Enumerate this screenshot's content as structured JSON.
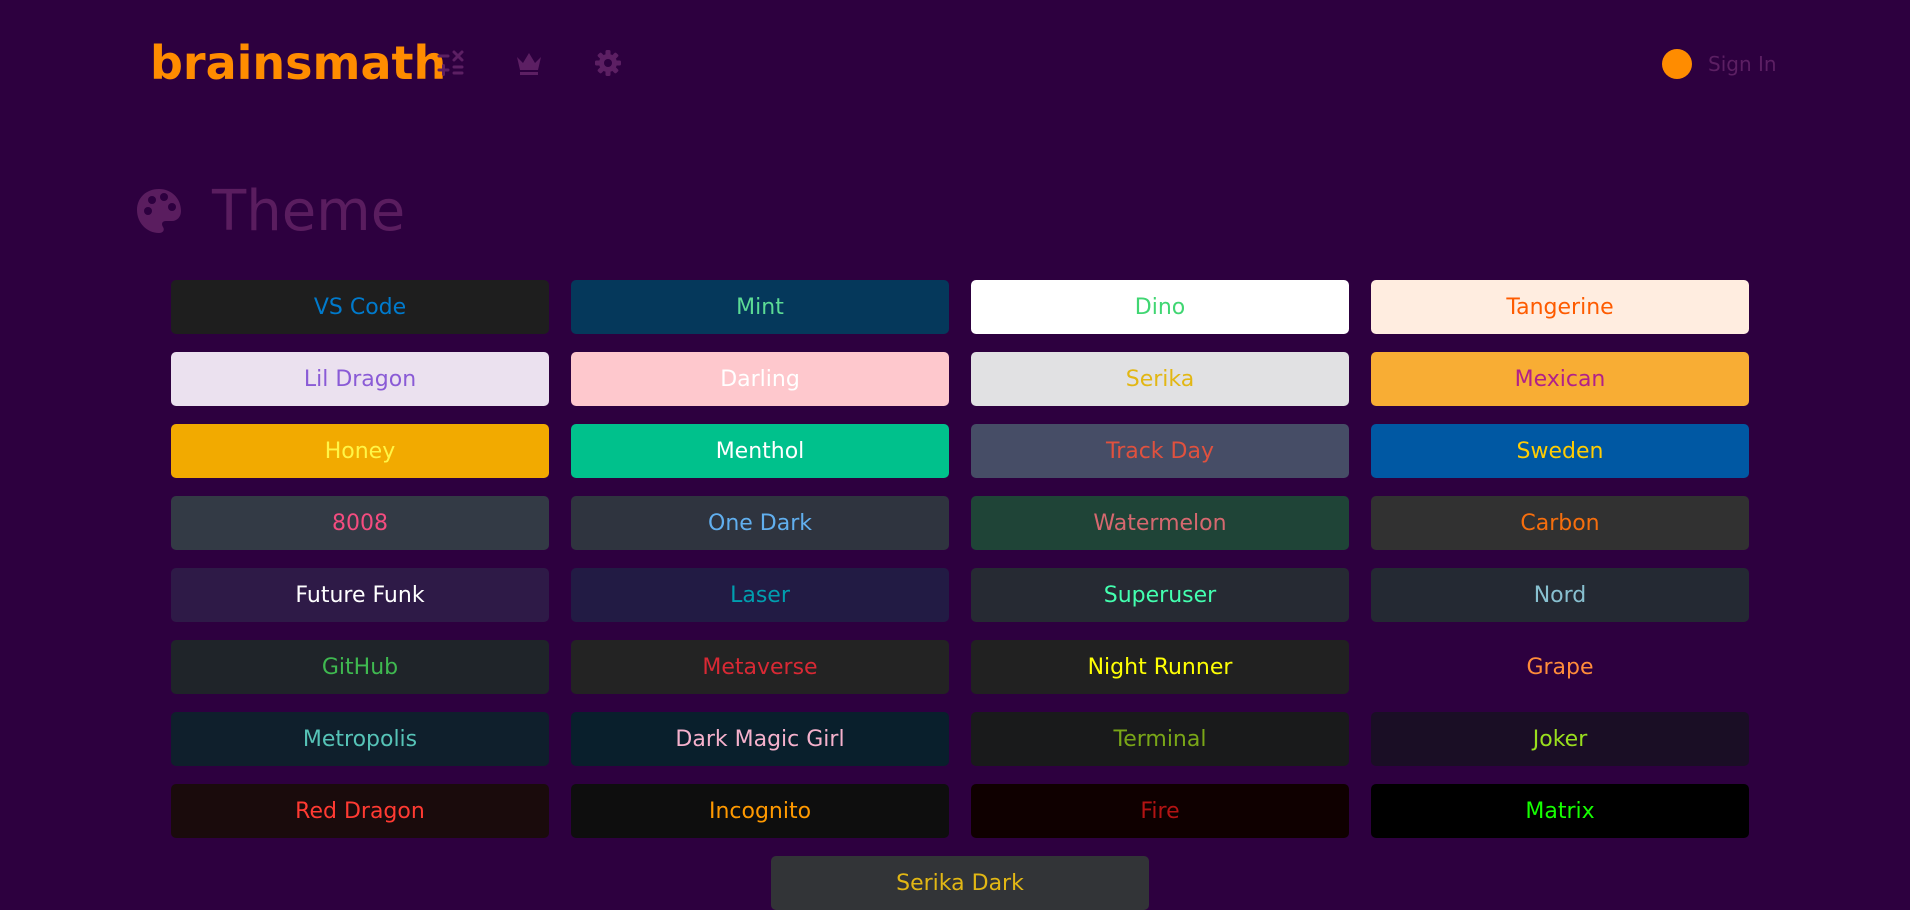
{
  "header": {
    "logo": "brainsmath",
    "nav_icons": [
      "calculator-icon",
      "crown-icon",
      "gear-icon"
    ],
    "sign_in_label": "Sign In"
  },
  "section": {
    "title": "Theme",
    "icon": "palette-icon"
  },
  "colors": {
    "background": "#2d003f",
    "accent": "#ff8c00",
    "muted": "#5c1f63"
  },
  "themes": [
    {
      "name": "VS Code",
      "bg": "#1e1e1e",
      "fg": "#007acc"
    },
    {
      "name": "Mint",
      "bg": "#05385b",
      "fg": "#5cdb95"
    },
    {
      "name": "Dino",
      "bg": "#ffffff",
      "fg": "#40d672"
    },
    {
      "name": "Tangerine",
      "bg": "#ffede0",
      "fg": "#fe5b00"
    },
    {
      "name": "Lil Dragon",
      "bg": "#ebe1ef",
      "fg": "#8a5bd6"
    },
    {
      "name": "Darling",
      "bg": "#fec8cd",
      "fg": "#ffffff"
    },
    {
      "name": "Serika",
      "bg": "#e1e1e3",
      "fg": "#e2b714"
    },
    {
      "name": "Mexican",
      "bg": "#f8ad34",
      "fg": "#b12189"
    },
    {
      "name": "Honey",
      "bg": "#f2aa00",
      "fg": "#fff546"
    },
    {
      "name": "Menthol",
      "bg": "#00c18c",
      "fg": "#ffffff"
    },
    {
      "name": "Track Day",
      "bg": "#464d66",
      "fg": "#e0513e"
    },
    {
      "name": "Sweden",
      "bg": "#0058a3",
      "fg": "#ffcc02"
    },
    {
      "name": "8008",
      "bg": "#333a45",
      "fg": "#f44c7f"
    },
    {
      "name": "One Dark",
      "bg": "#2f343f",
      "fg": "#61afef"
    },
    {
      "name": "Watermelon",
      "bg": "#1f4437",
      "fg": "#d6686f"
    },
    {
      "name": "Carbon",
      "bg": "#313131",
      "fg": "#f66e0d"
    },
    {
      "name": "Future Funk",
      "bg": "#2e1a47",
      "fg": "#ffffff"
    },
    {
      "name": "Laser",
      "bg": "#221b44",
      "fg": "#009eaf"
    },
    {
      "name": "Superuser",
      "bg": "#262a33",
      "fg": "#43ffaf"
    },
    {
      "name": "Nord",
      "bg": "#242933",
      "fg": "#88c0d0"
    },
    {
      "name": "GitHub",
      "bg": "#1f2429",
      "fg": "#3fb950"
    },
    {
      "name": "Metaverse",
      "bg": "#232323",
      "fg": "#d82934"
    },
    {
      "name": "Night Runner",
      "bg": "#212121",
      "fg": "#feff04"
    },
    {
      "name": "Grape",
      "bg": "#2d003f",
      "fg": "#ff8c3a"
    },
    {
      "name": "Metropolis",
      "bg": "#0f1f2c",
      "fg": "#56c3b7"
    },
    {
      "name": "Dark Magic Girl",
      "bg": "#091f2c",
      "fg": "#f5b1cc"
    },
    {
      "name": "Terminal",
      "bg": "#191a1b",
      "fg": "#79a617"
    },
    {
      "name": "Joker",
      "bg": "#1a0e25",
      "fg": "#99de1e"
    },
    {
      "name": "Red Dragon",
      "bg": "#1a0b0c",
      "fg": "#ff3a32"
    },
    {
      "name": "Incognito",
      "bg": "#0e0e0e",
      "fg": "#ff9900"
    },
    {
      "name": "Fire",
      "bg": "#0f0000",
      "fg": "#b31313"
    },
    {
      "name": "Matrix",
      "bg": "#000000",
      "fg": "#15ff00"
    },
    {
      "name": "Serika Dark",
      "bg": "#323437",
      "fg": "#e2b714"
    }
  ]
}
